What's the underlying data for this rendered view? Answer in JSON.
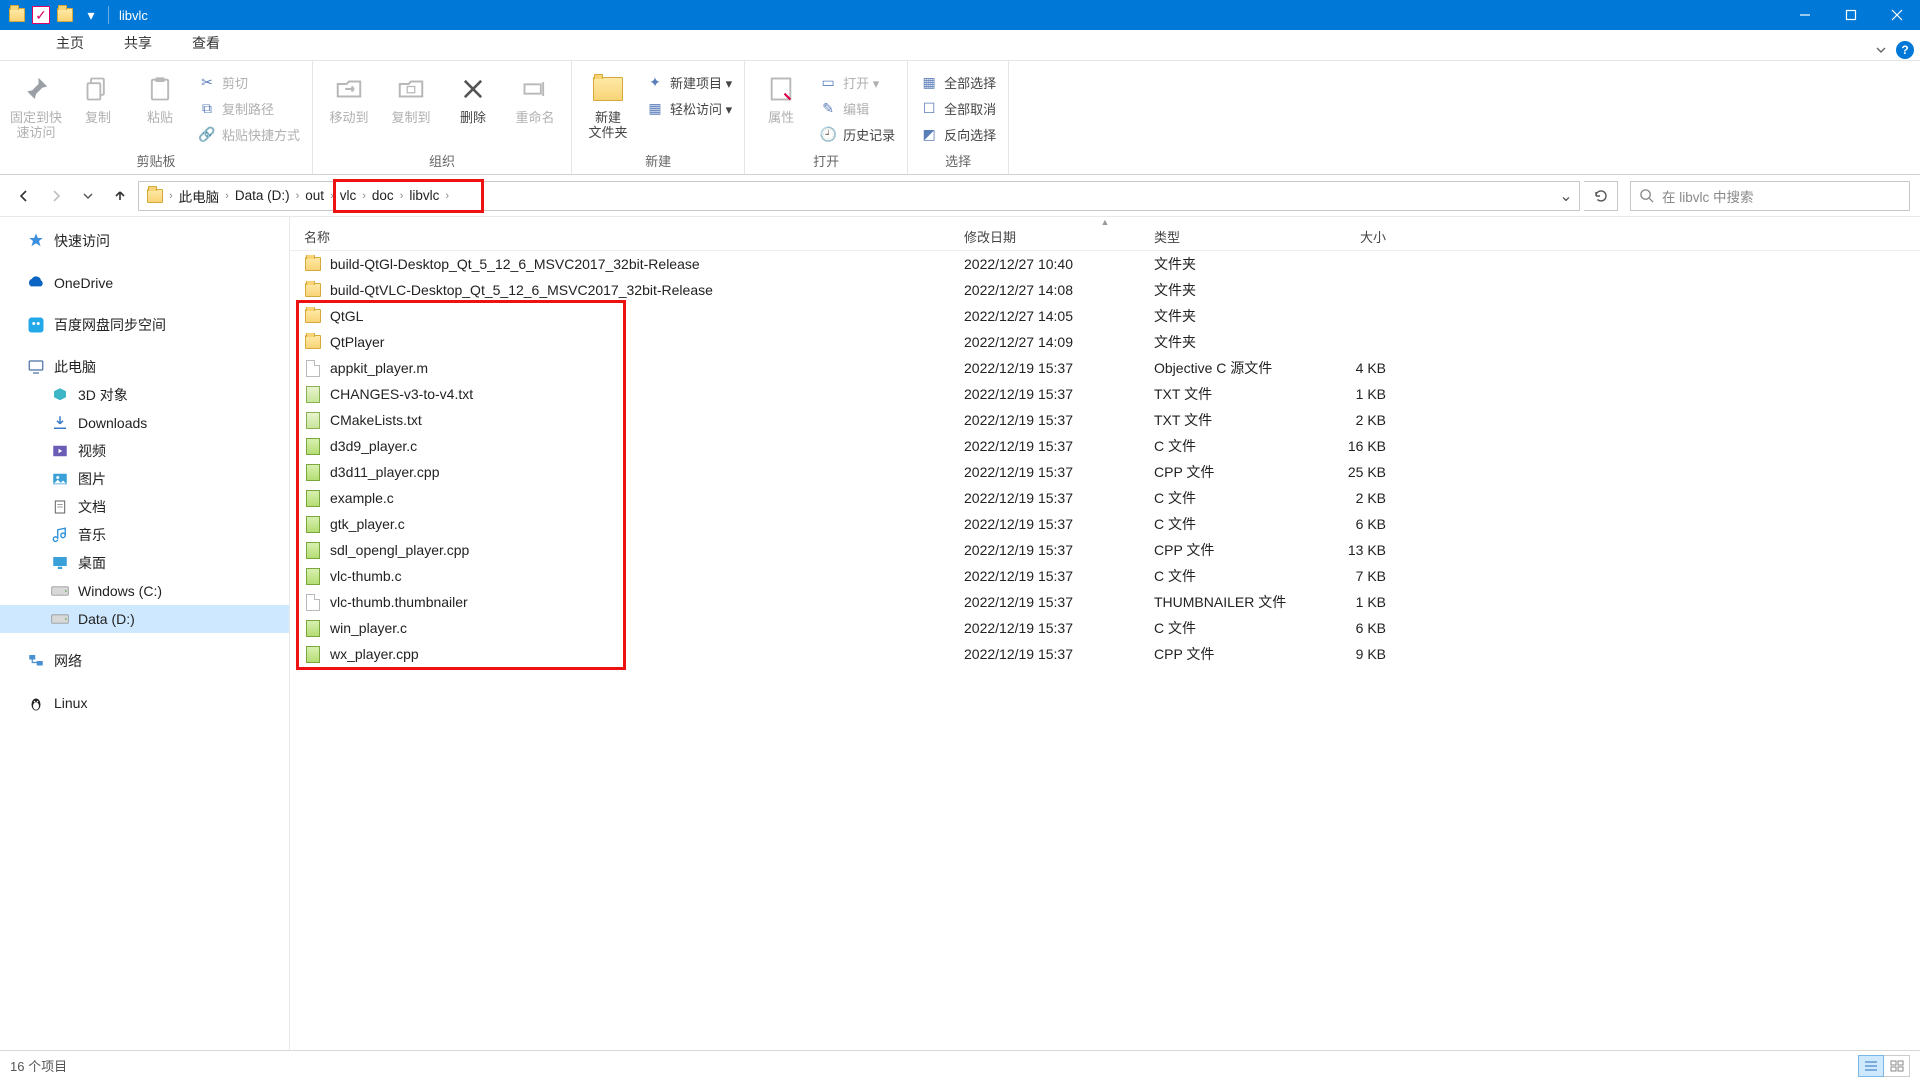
{
  "window": {
    "title": "libvlc"
  },
  "tabs": {
    "home": "主页",
    "share": "共享",
    "view": "查看"
  },
  "ribbon": {
    "pin": "固定到快\n速访问",
    "copy": "复制",
    "paste": "粘贴",
    "cut": "剪切",
    "copypath": "复制路径",
    "pasteshortcut": "粘贴快捷方式",
    "moveto": "移动到",
    "copyto": "复制到",
    "delete": "删除",
    "rename": "重命名",
    "newfolder": "新建\n文件夹",
    "newitem": "新建项目 ▾",
    "easyaccess": "轻松访问 ▾",
    "properties": "属性",
    "open": "打开 ▾",
    "edit": "编辑",
    "history": "历史记录",
    "selectall": "全部选择",
    "selectnone": "全部取消",
    "invertsel": "反向选择",
    "g_clipboard": "剪贴板",
    "g_organize": "组织",
    "g_new": "新建",
    "g_open": "打开",
    "g_select": "选择"
  },
  "breadcrumbs": [
    "此电脑",
    "Data (D:)",
    "out",
    "vlc",
    "doc",
    "libvlc"
  ],
  "search": {
    "placeholder": "在 libvlc 中搜索"
  },
  "tree": [
    {
      "icon": "star",
      "label": "快速访问",
      "indent": false
    },
    {
      "spacer": true
    },
    {
      "icon": "onedrive",
      "label": "OneDrive",
      "indent": false
    },
    {
      "spacer": true
    },
    {
      "icon": "baidu",
      "label": "百度网盘同步空间",
      "indent": false
    },
    {
      "spacer": true
    },
    {
      "icon": "pc",
      "label": "此电脑",
      "indent": false
    },
    {
      "icon": "3d",
      "label": "3D 对象",
      "indent": true
    },
    {
      "icon": "downloads",
      "label": "Downloads",
      "indent": true
    },
    {
      "icon": "videos",
      "label": "视频",
      "indent": true
    },
    {
      "icon": "pictures",
      "label": "图片",
      "indent": true
    },
    {
      "icon": "documents",
      "label": "文档",
      "indent": true
    },
    {
      "icon": "music",
      "label": "音乐",
      "indent": true
    },
    {
      "icon": "desktop",
      "label": "桌面",
      "indent": true
    },
    {
      "icon": "drive",
      "label": "Windows (C:)",
      "indent": true
    },
    {
      "icon": "drive",
      "label": "Data (D:)",
      "indent": true,
      "selected": true
    },
    {
      "spacer": true
    },
    {
      "icon": "network",
      "label": "网络",
      "indent": false
    },
    {
      "spacer": true
    },
    {
      "icon": "linux",
      "label": "Linux",
      "indent": false
    }
  ],
  "columns": {
    "name": "名称",
    "date": "修改日期",
    "type": "类型",
    "size": "大小"
  },
  "files": [
    {
      "icon": "folder",
      "name": "build-QtGl-Desktop_Qt_5_12_6_MSVC2017_32bit-Release",
      "date": "2022/12/27 10:40",
      "type": "文件夹",
      "size": ""
    },
    {
      "icon": "folder",
      "name": "build-QtVLC-Desktop_Qt_5_12_6_MSVC2017_32bit-Release",
      "date": "2022/12/27 14:08",
      "type": "文件夹",
      "size": ""
    },
    {
      "icon": "folder",
      "name": "QtGL",
      "date": "2022/12/27 14:05",
      "type": "文件夹",
      "size": ""
    },
    {
      "icon": "folder",
      "name": "QtPlayer",
      "date": "2022/12/27 14:09",
      "type": "文件夹",
      "size": ""
    },
    {
      "icon": "file",
      "name": "appkit_player.m",
      "date": "2022/12/19 15:37",
      "type": "Objective C 源文件",
      "size": "4 KB"
    },
    {
      "icon": "txt",
      "name": "CHANGES-v3-to-v4.txt",
      "date": "2022/12/19 15:37",
      "type": "TXT 文件",
      "size": "1 KB"
    },
    {
      "icon": "txt",
      "name": "CMakeLists.txt",
      "date": "2022/12/19 15:37",
      "type": "TXT 文件",
      "size": "2 KB"
    },
    {
      "icon": "code",
      "name": "d3d9_player.c",
      "date": "2022/12/19 15:37",
      "type": "C 文件",
      "size": "16 KB"
    },
    {
      "icon": "code",
      "name": "d3d11_player.cpp",
      "date": "2022/12/19 15:37",
      "type": "CPP 文件",
      "size": "25 KB"
    },
    {
      "icon": "code",
      "name": "example.c",
      "date": "2022/12/19 15:37",
      "type": "C 文件",
      "size": "2 KB"
    },
    {
      "icon": "code",
      "name": "gtk_player.c",
      "date": "2022/12/19 15:37",
      "type": "C 文件",
      "size": "6 KB"
    },
    {
      "icon": "code",
      "name": "sdl_opengl_player.cpp",
      "date": "2022/12/19 15:37",
      "type": "CPP 文件",
      "size": "13 KB"
    },
    {
      "icon": "code",
      "name": "vlc-thumb.c",
      "date": "2022/12/19 15:37",
      "type": "C 文件",
      "size": "7 KB"
    },
    {
      "icon": "file",
      "name": "vlc-thumb.thumbnailer",
      "date": "2022/12/19 15:37",
      "type": "THUMBNAILER 文件",
      "size": "1 KB"
    },
    {
      "icon": "code",
      "name": "win_player.c",
      "date": "2022/12/19 15:37",
      "type": "C 文件",
      "size": "6 KB"
    },
    {
      "icon": "code",
      "name": "wx_player.cpp",
      "date": "2022/12/19 15:37",
      "type": "CPP 文件",
      "size": "9 KB"
    }
  ],
  "highlight": {
    "addr_from": 3,
    "files_from": 2,
    "files_to": 15
  },
  "status": {
    "count": "16 个项目"
  }
}
